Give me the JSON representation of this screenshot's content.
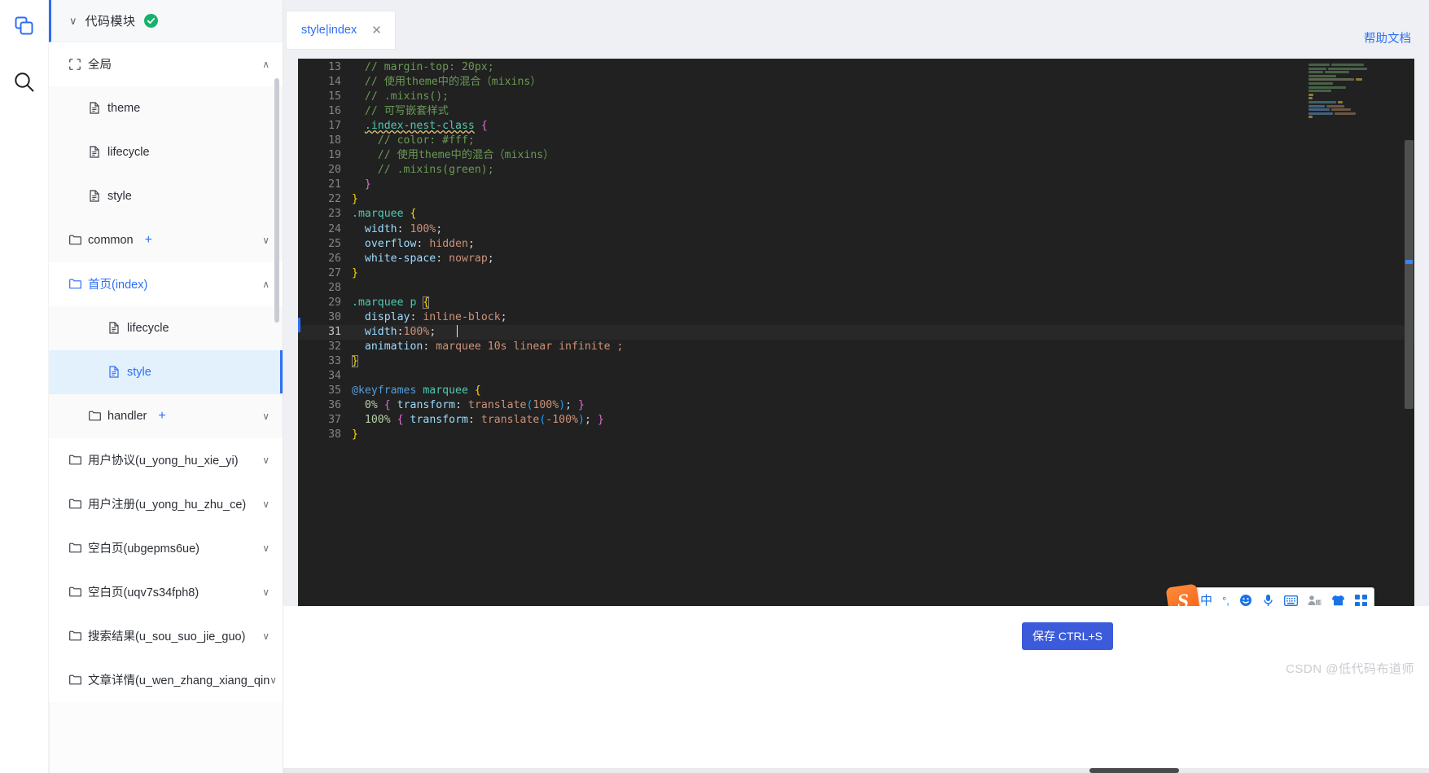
{
  "rail": {
    "items": [
      {
        "name": "copy-module-icon",
        "label": "代码模块"
      },
      {
        "name": "search-icon",
        "label": "搜索"
      }
    ]
  },
  "sidebar": {
    "module": {
      "title": "代码模块",
      "status": "ok",
      "caret": "∨"
    },
    "items": [
      {
        "label": "全局",
        "type": "global",
        "indent": 1,
        "chevron": "∧",
        "blue": false,
        "selected": false,
        "plus": "",
        "alt": false
      },
      {
        "label": "theme",
        "type": "file",
        "indent": 2,
        "chevron": "",
        "blue": false,
        "selected": false,
        "plus": "",
        "alt": true
      },
      {
        "label": "lifecycle",
        "type": "file",
        "indent": 2,
        "chevron": "",
        "blue": false,
        "selected": false,
        "plus": "",
        "alt": true
      },
      {
        "label": "style",
        "type": "file",
        "indent": 2,
        "chevron": "",
        "blue": false,
        "selected": false,
        "plus": "",
        "alt": true
      },
      {
        "label": "common",
        "type": "folder",
        "indent": 1,
        "chevron": "∨",
        "blue": false,
        "selected": false,
        "plus": "+",
        "alt": true
      },
      {
        "label": "首页(index)",
        "type": "folder",
        "indent": 1,
        "chevron": "∧",
        "blue": true,
        "selected": false,
        "plus": "",
        "alt": false
      },
      {
        "label": "lifecycle",
        "type": "file",
        "indent": 3,
        "chevron": "",
        "blue": false,
        "selected": false,
        "plus": "",
        "alt": true
      },
      {
        "label": "style",
        "type": "file",
        "indent": 3,
        "chevron": "",
        "blue": true,
        "selected": true,
        "plus": "",
        "alt": false
      },
      {
        "label": "handler",
        "type": "folder",
        "indent": 2,
        "chevron": "∨",
        "blue": false,
        "selected": false,
        "plus": "+",
        "alt": true
      },
      {
        "label": "用户协议(u_yong_hu_xie_yi)",
        "type": "folder",
        "indent": 1,
        "chevron": "∨",
        "blue": false,
        "selected": false,
        "plus": "",
        "alt": false
      },
      {
        "label": "用户注册(u_yong_hu_zhu_ce)",
        "type": "folder",
        "indent": 1,
        "chevron": "∨",
        "blue": false,
        "selected": false,
        "plus": "",
        "alt": false
      },
      {
        "label": "空白页(ubgepms6ue)",
        "type": "folder",
        "indent": 1,
        "chevron": "∨",
        "blue": false,
        "selected": false,
        "plus": "",
        "alt": false
      },
      {
        "label": "空白页(uqv7s34fph8)",
        "type": "folder",
        "indent": 1,
        "chevron": "∨",
        "blue": false,
        "selected": false,
        "plus": "",
        "alt": false
      },
      {
        "label": "搜索结果(u_sou_suo_jie_guo)",
        "type": "folder",
        "indent": 1,
        "chevron": "∨",
        "blue": false,
        "selected": false,
        "plus": "",
        "alt": false
      },
      {
        "label": "文章详情(u_wen_zhang_xiang_qin",
        "type": "folder",
        "indent": 1,
        "chevron": "∨",
        "blue": false,
        "selected": false,
        "plus": "",
        "alt": false
      }
    ]
  },
  "tabs": [
    {
      "label": "style|index",
      "close": "✕",
      "active": true
    }
  ],
  "header": {
    "help_link": "帮助文档"
  },
  "editor": {
    "first_line": 13,
    "active_line": 31,
    "cursor_line": 31,
    "lines": [
      {
        "n": 13,
        "tokens": [
          {
            "t": "  ",
            "c": "t-pun"
          },
          {
            "t": "// margin-top: 20px;",
            "c": "t-com"
          }
        ]
      },
      {
        "n": 14,
        "tokens": [
          {
            "t": "  ",
            "c": "t-pun"
          },
          {
            "t": "// 使用theme中的混合（mixins）",
            "c": "t-com"
          }
        ]
      },
      {
        "n": 15,
        "tokens": [
          {
            "t": "  ",
            "c": "t-pun"
          },
          {
            "t": "// .mixins();",
            "c": "t-com"
          }
        ]
      },
      {
        "n": 16,
        "tokens": [
          {
            "t": "  ",
            "c": "t-pun"
          },
          {
            "t": "// 可写嵌套样式",
            "c": "t-com"
          }
        ]
      },
      {
        "n": 17,
        "tokens": [
          {
            "t": "  ",
            "c": "t-pun"
          },
          {
            "t": ".index-nest-class",
            "c": "t-sel squig"
          },
          {
            "t": " ",
            "c": "t-pun"
          },
          {
            "t": "{",
            "c": "t-br2"
          }
        ]
      },
      {
        "n": 18,
        "tokens": [
          {
            "t": "    ",
            "c": "t-pun"
          },
          {
            "t": "// color: #fff;",
            "c": "t-com"
          }
        ]
      },
      {
        "n": 19,
        "tokens": [
          {
            "t": "    ",
            "c": "t-pun"
          },
          {
            "t": "// 使用theme中的混合（mixins）",
            "c": "t-com"
          }
        ]
      },
      {
        "n": 20,
        "tokens": [
          {
            "t": "    ",
            "c": "t-pun"
          },
          {
            "t": "// .mixins(green);",
            "c": "t-com"
          }
        ]
      },
      {
        "n": 21,
        "tokens": [
          {
            "t": "  ",
            "c": "t-pun"
          },
          {
            "t": "}",
            "c": "t-br2"
          }
        ]
      },
      {
        "n": 22,
        "tokens": [
          {
            "t": "}",
            "c": "t-br1"
          }
        ]
      },
      {
        "n": 23,
        "tokens": [
          {
            "t": ".marquee",
            "c": "t-sel"
          },
          {
            "t": " ",
            "c": "t-pun"
          },
          {
            "t": "{",
            "c": "t-br1"
          }
        ]
      },
      {
        "n": 24,
        "tokens": [
          {
            "t": "  ",
            "c": "t-pun"
          },
          {
            "t": "width",
            "c": "t-prop"
          },
          {
            "t": ": ",
            "c": "t-pun"
          },
          {
            "t": "100%",
            "c": "t-val"
          },
          {
            "t": ";",
            "c": "t-pun"
          }
        ]
      },
      {
        "n": 25,
        "tokens": [
          {
            "t": "  ",
            "c": "t-pun"
          },
          {
            "t": "overflow",
            "c": "t-prop"
          },
          {
            "t": ": ",
            "c": "t-pun"
          },
          {
            "t": "hidden",
            "c": "t-val"
          },
          {
            "t": ";",
            "c": "t-pun"
          }
        ]
      },
      {
        "n": 26,
        "tokens": [
          {
            "t": "  ",
            "c": "t-pun"
          },
          {
            "t": "white-space",
            "c": "t-prop"
          },
          {
            "t": ": ",
            "c": "t-pun"
          },
          {
            "t": "nowrap",
            "c": "t-val"
          },
          {
            "t": ";",
            "c": "t-pun"
          }
        ]
      },
      {
        "n": 27,
        "tokens": [
          {
            "t": "}",
            "c": "t-br1"
          }
        ]
      },
      {
        "n": 28,
        "tokens": []
      },
      {
        "n": 29,
        "tokens": [
          {
            "t": ".marquee p",
            "c": "t-sel"
          },
          {
            "t": " ",
            "c": "t-pun"
          },
          {
            "t": "{",
            "c": "t-br1 brace-box"
          }
        ]
      },
      {
        "n": 30,
        "tokens": [
          {
            "t": "  ",
            "c": "t-pun"
          },
          {
            "t": "display",
            "c": "t-prop"
          },
          {
            "t": ": ",
            "c": "t-pun"
          },
          {
            "t": "inline-block",
            "c": "t-val"
          },
          {
            "t": ";",
            "c": "t-pun"
          }
        ]
      },
      {
        "n": 31,
        "tokens": [
          {
            "t": "  ",
            "c": "t-pun"
          },
          {
            "t": "width",
            "c": "t-prop"
          },
          {
            "t": ":",
            "c": "t-pun"
          },
          {
            "t": "100%",
            "c": "t-val"
          },
          {
            "t": ";",
            "c": "t-pun"
          }
        ]
      },
      {
        "n": 32,
        "tokens": [
          {
            "t": "  ",
            "c": "t-pun"
          },
          {
            "t": "animation",
            "c": "t-prop"
          },
          {
            "t": ": ",
            "c": "t-pun"
          },
          {
            "t": "marquee 10s linear infinite ;",
            "c": "t-val"
          }
        ]
      },
      {
        "n": 33,
        "tokens": [
          {
            "t": "}",
            "c": "t-br1 brace-box"
          }
        ]
      },
      {
        "n": 34,
        "tokens": []
      },
      {
        "n": 35,
        "tokens": [
          {
            "t": "@keyframes",
            "c": "t-key"
          },
          {
            "t": " ",
            "c": "t-pun"
          },
          {
            "t": "marquee",
            "c": "t-sel"
          },
          {
            "t": " ",
            "c": "t-pun"
          },
          {
            "t": "{",
            "c": "t-br1"
          }
        ]
      },
      {
        "n": 36,
        "tokens": [
          {
            "t": "  ",
            "c": "t-pun"
          },
          {
            "t": "0%",
            "c": "t-num"
          },
          {
            "t": " ",
            "c": "t-pun"
          },
          {
            "t": "{",
            "c": "t-br2"
          },
          {
            "t": " ",
            "c": "t-pun"
          },
          {
            "t": "transform",
            "c": "t-prop"
          },
          {
            "t": ": ",
            "c": "t-pun"
          },
          {
            "t": "translate",
            "c": "t-val"
          },
          {
            "t": "(",
            "c": "t-br3"
          },
          {
            "t": "100%",
            "c": "t-val"
          },
          {
            "t": ")",
            "c": "t-br3"
          },
          {
            "t": "; ",
            "c": "t-pun"
          },
          {
            "t": "}",
            "c": "t-br2"
          }
        ]
      },
      {
        "n": 37,
        "tokens": [
          {
            "t": "  ",
            "c": "t-pun"
          },
          {
            "t": "100%",
            "c": "t-num"
          },
          {
            "t": " ",
            "c": "t-pun"
          },
          {
            "t": "{",
            "c": "t-br2"
          },
          {
            "t": " ",
            "c": "t-pun"
          },
          {
            "t": "transform",
            "c": "t-prop"
          },
          {
            "t": ": ",
            "c": "t-pun"
          },
          {
            "t": "translate",
            "c": "t-val"
          },
          {
            "t": "(",
            "c": "t-br3"
          },
          {
            "t": "-100%",
            "c": "t-val"
          },
          {
            "t": ")",
            "c": "t-br3"
          },
          {
            "t": "; ",
            "c": "t-pun"
          },
          {
            "t": "}",
            "c": "t-br2"
          }
        ]
      },
      {
        "n": 38,
        "tokens": [
          {
            "t": "}",
            "c": "t-br1"
          }
        ]
      }
    ]
  },
  "ime": {
    "logo_text": "S",
    "items": [
      {
        "name": "language-mode",
        "glyph": "中",
        "grey": false
      },
      {
        "name": "punctuation-mode",
        "glyph": "°,",
        "grey": false
      },
      {
        "name": "emoji-icon",
        "glyph": "☺",
        "grey": false
      },
      {
        "name": "voice-input-icon",
        "glyph": "🎤",
        "grey": false
      },
      {
        "name": "soft-keyboard-icon",
        "glyph": "⌨",
        "grey": false
      },
      {
        "name": "user-center-icon",
        "glyph": "👤",
        "grey": true
      },
      {
        "name": "skin-icon",
        "glyph": "👕",
        "grey": false
      },
      {
        "name": "toolbox-icon",
        "glyph": "⠿",
        "grey": false
      }
    ]
  },
  "footer": {
    "save_label": "保存 CTRL+S",
    "watermark": "CSDN @低代码布道师"
  },
  "colors": {
    "accent": "#2d6ef5",
    "save_button": "#3b5bdb",
    "selected_row": "#e3f1fd",
    "editor_bg": "#212121",
    "ok_badge": "#17b26a"
  }
}
